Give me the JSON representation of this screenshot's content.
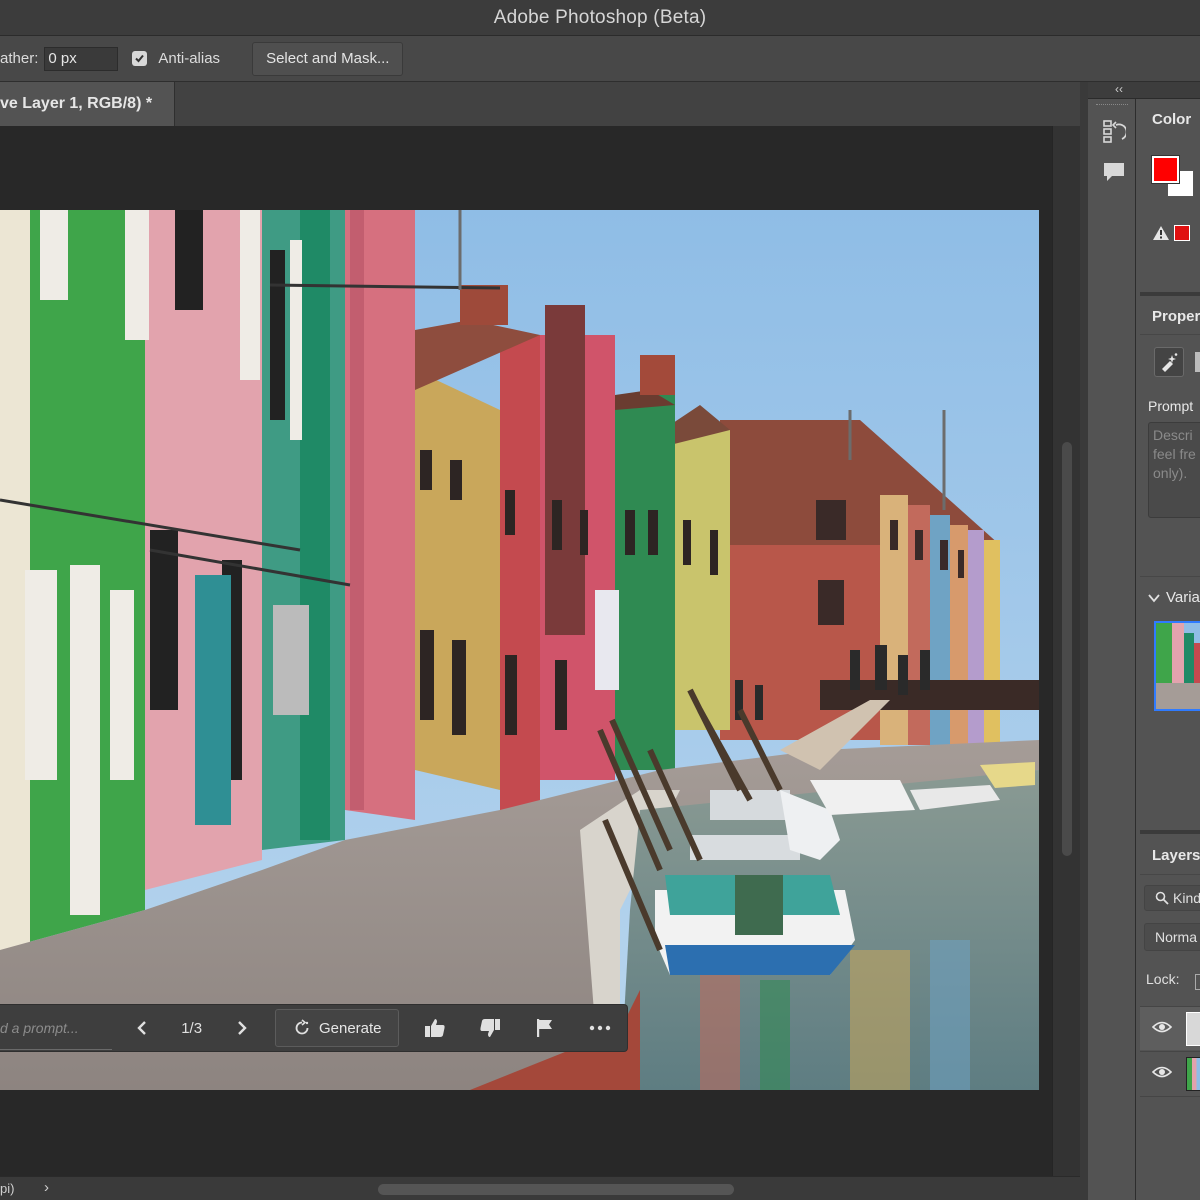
{
  "window": {
    "title": "Adobe Photoshop (Beta)"
  },
  "options_bar": {
    "feather_label": "ather:",
    "feather_value": "0 px",
    "anti_alias_label": "Anti-alias",
    "anti_alias_checked": true,
    "select_mask_label": "Select and Mask..."
  },
  "document_tab": {
    "label": "ve Layer 1, RGB/8) *"
  },
  "taskbar": {
    "prompt_placeholder": "d a prompt...",
    "variation_counter": "1/3",
    "generate_label": "Generate"
  },
  "status_bar": {
    "zoom_fragment": "pi)"
  },
  "panels": {
    "color": {
      "title": "Color",
      "foreground": "#ff0000",
      "background": "#ffffff"
    },
    "properties": {
      "title": "Proper",
      "prompt_label": "Prompt",
      "prompt_placeholder_lines": [
        "Descri",
        "feel fre",
        "only)."
      ]
    },
    "variations": {
      "title": "Varia"
    },
    "layers": {
      "title": "Layers",
      "search_label": "Kind",
      "blend_mode": "Norma",
      "lock_label": "Lock:"
    }
  },
  "icons": {
    "options_check": "checkmark-icon",
    "taskbar": [
      "chevron-left-icon",
      "chevron-right-icon",
      "refresh-icon",
      "thumbs-up-icon",
      "thumbs-down-icon",
      "flag-icon",
      "more-icon"
    ],
    "strip": [
      "history-icon",
      "comment-icon"
    ],
    "properties": "generative-fill-icon",
    "layers": [
      "search-icon",
      "eye-icon"
    ]
  },
  "colors": {
    "accent_blue": "#2f7bff",
    "panel_bg": "#535353",
    "pasteboard": "#282828"
  }
}
